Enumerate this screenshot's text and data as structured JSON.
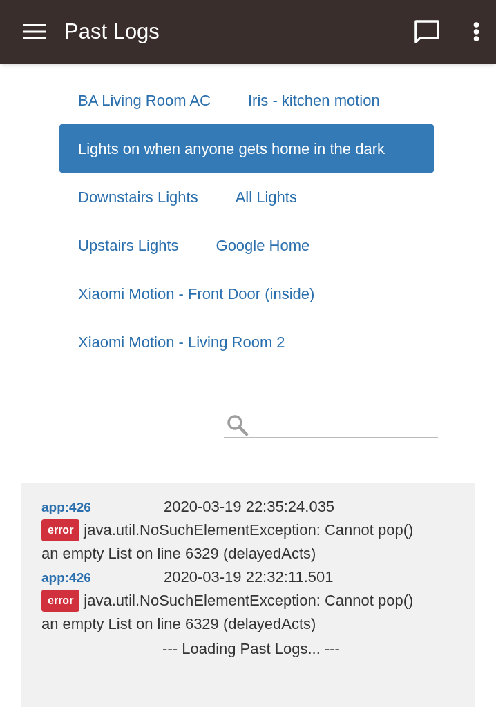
{
  "app_bar": {
    "title": "Past Logs"
  },
  "filters": [
    {
      "label": "BA Living Room AC",
      "selected": false
    },
    {
      "label": "Iris - kitchen motion",
      "selected": false
    },
    {
      "label": "Lights on when anyone gets home in the dark",
      "selected": true
    },
    {
      "label": "Downstairs Lights",
      "selected": false
    },
    {
      "label": "All Lights",
      "selected": false
    },
    {
      "label": "Upstairs Lights",
      "selected": false
    },
    {
      "label": "Google Home",
      "selected": false
    },
    {
      "label": "Xiaomi Motion - Front Door (inside)",
      "selected": false
    },
    {
      "label": "Xiaomi Motion - Living Room 2",
      "selected": false
    }
  ],
  "logs": [
    {
      "source": "app:426",
      "time": "2020-03-19 22:35:24.035",
      "level": "error",
      "message_lines": [
        "java.util.NoSuchElementException: Cannot pop()",
        "an empty List on line 6329 (delayedActs)"
      ]
    },
    {
      "source": "app:426",
      "time": "2020-03-19 22:32:11.501",
      "level": "error",
      "message_lines": [
        "java.util.NoSuchElementException: Cannot pop()",
        "an empty List on line 6329 (delayedActs)"
      ]
    }
  ],
  "loading_text": "--- Loading Past Logs... ---"
}
